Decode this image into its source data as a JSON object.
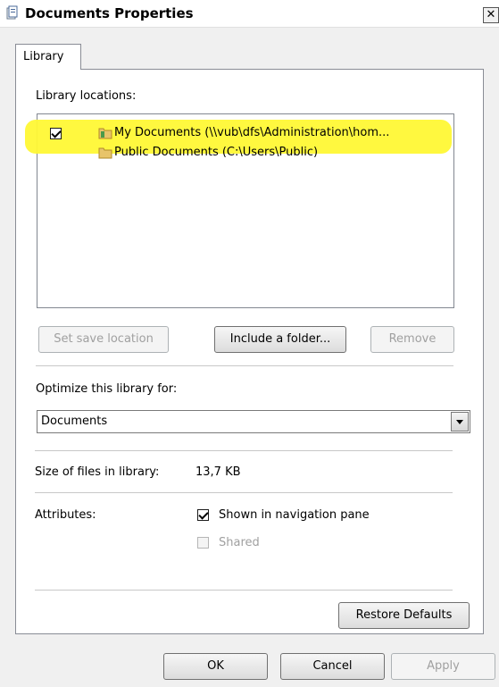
{
  "window": {
    "title": "Documents Properties",
    "close_label": "✕"
  },
  "tabs": [
    {
      "label": "Library",
      "selected": true
    }
  ],
  "library": {
    "locations_label": "Library locations:",
    "locations": [
      {
        "label": "My Documents (\\\\vub\\dfs\\Administration\\hom...",
        "is_save_location": true
      },
      {
        "label": "Public Documents (C:\\Users\\Public)",
        "is_save_location": false
      }
    ],
    "buttons": {
      "set_save_location": "Set save location",
      "include_folder": "Include a folder...",
      "remove": "Remove"
    }
  },
  "optimize": {
    "label": "Optimize this library for:",
    "selected": "Documents"
  },
  "size": {
    "label": "Size of files in library:",
    "value": "13,7 KB"
  },
  "attributes": {
    "label": "Attributes:",
    "shown_in_nav": {
      "label": "Shown in navigation pane",
      "checked": true
    },
    "shared": {
      "label": "Shared",
      "checked": false,
      "disabled": true
    }
  },
  "restore_defaults": "Restore Defaults",
  "footer": {
    "ok": "OK",
    "cancel": "Cancel",
    "apply": "Apply"
  },
  "colors": {
    "highlight": "#fff835",
    "window_bg": "#f0f0f0",
    "panel_bg": "#ffffff"
  }
}
